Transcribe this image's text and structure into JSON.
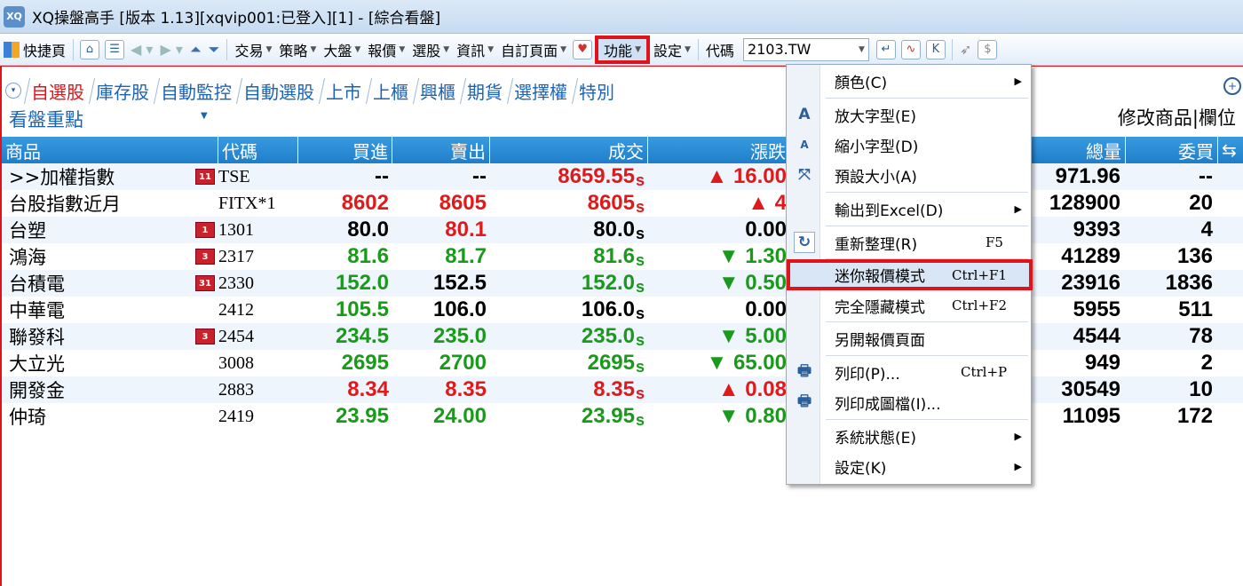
{
  "window": {
    "title": "XQ操盤高手 [版本 1.13][xqvip001:已登入][1] - [綜合看盤]",
    "logo": "XQ"
  },
  "toolbar": {
    "quick": "快捷頁",
    "trade": "交易",
    "strategy": "策略",
    "market": "大盤",
    "quote": "報價",
    "select": "選股",
    "info": "資訊",
    "custom": "自訂頁面",
    "func": "功能",
    "settings": "設定",
    "code_label": "代碼",
    "symbol": "2103.TW"
  },
  "tabs": [
    "自選股",
    "庫存股",
    "自動監控",
    "自動選股",
    "上市",
    "上櫃",
    "興櫃",
    "期貨",
    "選擇權",
    "特別"
  ],
  "view": {
    "focus": "看盤重點",
    "edit": "修改商品|欄位"
  },
  "headers": {
    "name": "商品",
    "code": "代碼",
    "bid": "買進",
    "ask": "賣出",
    "last": "成交",
    "chg": "漲跌",
    "vol": "總量",
    "bq": "委買"
  },
  "rows": [
    {
      "name": ">>加權指數",
      "badge": "11",
      "code": "TSE",
      "bid": "--",
      "ask": "--",
      "last": "8659.55",
      "s": "s",
      "chg": "▲ 16.00",
      "vol": "971.96",
      "bq": "--",
      "cb": "black",
      "ca": "black",
      "cl": "red",
      "cc": "red"
    },
    {
      "name": "台股指數近月",
      "badge": "",
      "code": "FITX*1",
      "bid": "8602",
      "ask": "8605",
      "last": "8605",
      "s": "s",
      "chg": "▲ 4",
      "vol": "128900",
      "bq": "20",
      "cb": "red",
      "ca": "red",
      "cl": "red",
      "cc": "red"
    },
    {
      "name": "台塑",
      "badge": "1",
      "code": "1301",
      "bid": "80.0",
      "ask": "80.1",
      "last": "80.0",
      "s": "s",
      "chg": "0.00",
      "vol": "9393",
      "bq": "4",
      "cb": "black",
      "ca": "red",
      "cl": "black",
      "cc": "black"
    },
    {
      "name": "鴻海",
      "badge": "3",
      "code": "2317",
      "bid": "81.6",
      "ask": "81.7",
      "last": "81.6",
      "s": "s",
      "chg": "▼ 1.30",
      "vol": "41289",
      "bq": "136",
      "cb": "green",
      "ca": "green",
      "cl": "green",
      "cc": "green"
    },
    {
      "name": "台積電",
      "badge": "31",
      "code": "2330",
      "bid": "152.0",
      "ask": "152.5",
      "last": "152.0",
      "s": "s",
      "chg": "▼ 0.50",
      "vol": "23916",
      "bq": "1836",
      "cb": "green",
      "ca": "black",
      "cl": "green",
      "cc": "green"
    },
    {
      "name": "中華電",
      "badge": "",
      "code": "2412",
      "bid": "105.5",
      "ask": "106.0",
      "last": "106.0",
      "s": "s",
      "chg": "0.00",
      "vol": "5955",
      "bq": "511",
      "cb": "green",
      "ca": "black",
      "cl": "black",
      "cc": "black"
    },
    {
      "name": "聯發科",
      "badge": "3",
      "code": "2454",
      "bid": "234.5",
      "ask": "235.0",
      "last": "235.0",
      "s": "s",
      "chg": "▼ 5.00",
      "vol": "4544",
      "bq": "78",
      "cb": "green",
      "ca": "green",
      "cl": "green",
      "cc": "green"
    },
    {
      "name": "大立光",
      "badge": "",
      "code": "3008",
      "bid": "2695",
      "ask": "2700",
      "last": "2695",
      "s": "s",
      "chg": "▼ 65.00",
      "vol": "949",
      "bq": "2",
      "cb": "green",
      "ca": "green",
      "cl": "green",
      "cc": "green"
    },
    {
      "name": "開發金",
      "badge": "",
      "code": "2883",
      "bid": "8.34",
      "ask": "8.35",
      "last": "8.35",
      "s": "s",
      "chg": "▲ 0.08",
      "vol": "30549",
      "bq": "10",
      "cb": "red",
      "ca": "red",
      "cl": "red",
      "cc": "red"
    },
    {
      "name": "仲琦",
      "badge": "",
      "code": "2419",
      "bid": "23.95",
      "ask": "24.00",
      "last": "23.95",
      "s": "s",
      "chg": "▼ 0.80",
      "vol": "11095",
      "bq": "172",
      "cb": "green",
      "ca": "green",
      "cl": "green",
      "cc": "green"
    }
  ],
  "menu": {
    "color": "顏色(C)",
    "enlarge": "放大字型(E)",
    "shrink": "縮小字型(D)",
    "default_size": "預設大小(A)",
    "excel": "輸出到Excel(D)",
    "refresh": "重新整理(R)",
    "refresh_key": "F5",
    "mini": "迷你報價模式",
    "mini_key": "Ctrl+F1",
    "hide": "完全隱藏模式",
    "hide_key": "Ctrl+F2",
    "newpage": "另開報價頁面",
    "print": "列印(P)...",
    "print_key": "Ctrl+P",
    "print_img": "列印成圖檔(I)...",
    "status": "系統狀態(E)",
    "setting": "設定(K)"
  }
}
